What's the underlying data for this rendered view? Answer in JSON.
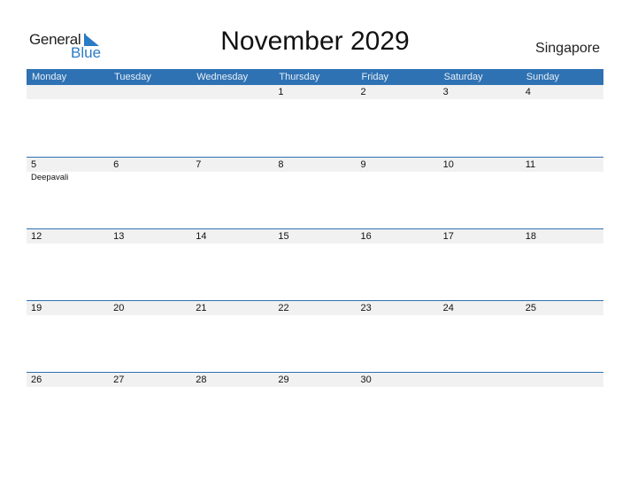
{
  "logo": {
    "word1": "General",
    "word2": "Blue"
  },
  "title": "November 2029",
  "country": "Singapore",
  "weekdays": [
    "Monday",
    "Tuesday",
    "Wednesday",
    "Thursday",
    "Friday",
    "Saturday",
    "Sunday"
  ],
  "weeks": [
    {
      "days": [
        "",
        "",
        "",
        "1",
        "2",
        "3",
        "4"
      ],
      "events": [
        "",
        "",
        "",
        "",
        "",
        "",
        ""
      ]
    },
    {
      "days": [
        "5",
        "6",
        "7",
        "8",
        "9",
        "10",
        "11"
      ],
      "events": [
        "Deepavali",
        "",
        "",
        "",
        "",
        "",
        ""
      ]
    },
    {
      "days": [
        "12",
        "13",
        "14",
        "15",
        "16",
        "17",
        "18"
      ],
      "events": [
        "",
        "",
        "",
        "",
        "",
        "",
        ""
      ]
    },
    {
      "days": [
        "19",
        "20",
        "21",
        "22",
        "23",
        "24",
        "25"
      ],
      "events": [
        "",
        "",
        "",
        "",
        "",
        "",
        ""
      ]
    },
    {
      "days": [
        "26",
        "27",
        "28",
        "29",
        "30",
        "",
        ""
      ],
      "events": [
        "",
        "",
        "",
        "",
        "",
        "",
        ""
      ]
    }
  ]
}
